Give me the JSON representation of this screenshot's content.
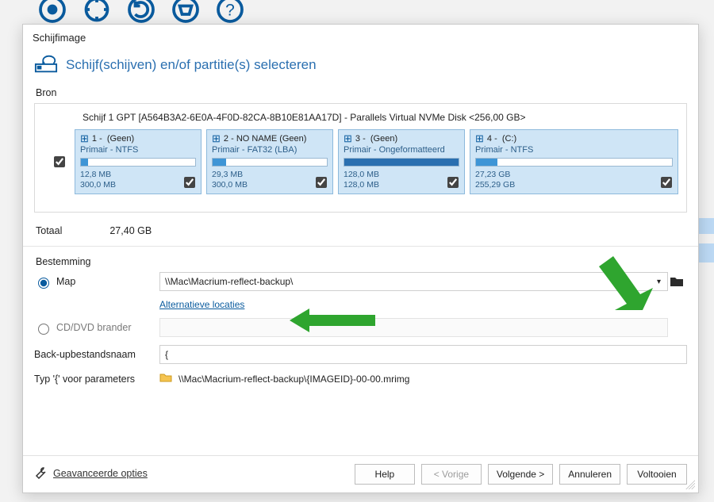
{
  "dialog": {
    "title": "Schijfimage",
    "heading": "Schijf(schijven) en/of partitie(s) selecteren"
  },
  "source": {
    "label": "Bron",
    "disk_label": "Schijf 1 GPT [A564B3A2-6E0A-4F0D-82CA-8B10E81AA17D] - Parallels Virtual NVMe Disk  <256,00 GB>",
    "disk_checked": true,
    "partitions": [
      {
        "num": "1",
        "name": "(Geen)",
        "sub": "Primair - NTFS",
        "size_used": "12,8 MB",
        "size_total": "300,0 MB",
        "checked": true,
        "fill_pct": 6
      },
      {
        "num": "2",
        "name": "NO NAME (Geen)",
        "sub": "Primair - FAT32 (LBA)",
        "size_used": "29,3 MB",
        "size_total": "300,0 MB",
        "checked": true,
        "fill_pct": 12
      },
      {
        "num": "3",
        "name": "(Geen)",
        "sub": "Primair - Ongeformatteerd",
        "size_used": "128,0 MB",
        "size_total": "128,0 MB",
        "checked": true,
        "fill_pct": 100
      },
      {
        "num": "4",
        "name": "(C:)",
        "sub": "Primair - NTFS",
        "size_used": "27,23 GB",
        "size_total": "255,29 GB",
        "checked": true,
        "fill_pct": 11
      }
    ],
    "total_label": "Totaal",
    "total_value": "27,40 GB"
  },
  "destination": {
    "label": "Bestemming",
    "folder_radio": "Map",
    "path": "\\\\Mac\\Macrium-reflect-backup\\",
    "alt_link": "Alternatieve locaties",
    "cd_radio": "CD/DVD brander",
    "filename_label": "Back-upbestandsnaam",
    "filename_value": "{",
    "params_label": "Typ '{' voor parameters",
    "params_value": "\\\\Mac\\Macrium-reflect-backup\\{IMAGEID}-00-00.mrimg"
  },
  "advanced": "Geavanceerde opties",
  "buttons": {
    "help": "Help",
    "prev": "< Vorige",
    "next": "Volgende >",
    "cancel": "Annuleren",
    "finish": "Voltooien"
  }
}
